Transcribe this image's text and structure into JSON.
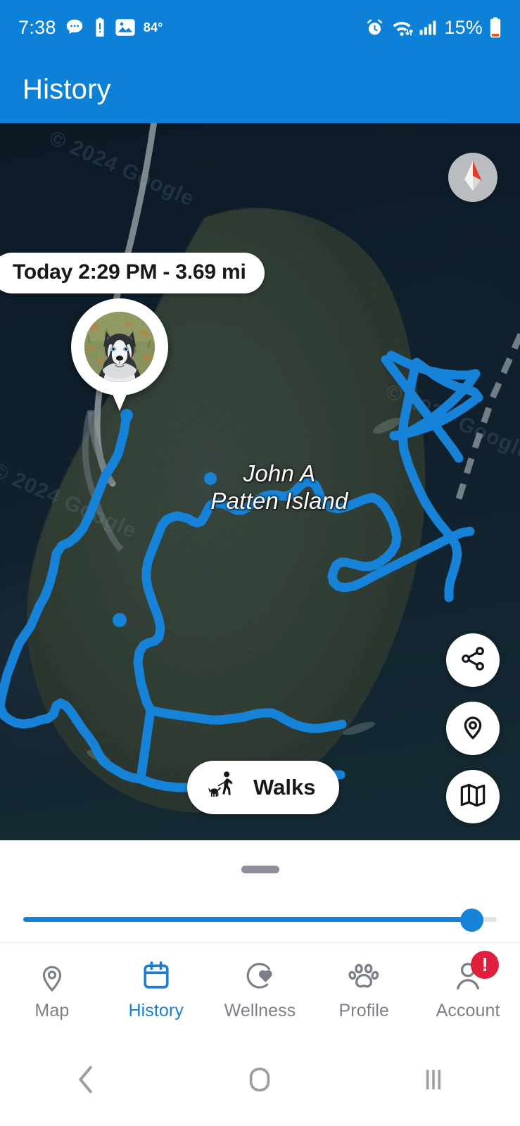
{
  "status_bar": {
    "time": "7:38",
    "temperature": "84°",
    "battery_percent": "15%",
    "icons": [
      "message-icon",
      "battery-alert-icon",
      "photo-icon",
      "alarm-icon",
      "wifi-icon",
      "cellular-signal-icon",
      "battery-icon"
    ]
  },
  "app_bar": {
    "title": "History"
  },
  "map": {
    "place_label_line1": "John A",
    "place_label_line2": "Patten Island",
    "watermark": "© 2024 Google",
    "compass_name": "compass-control",
    "info_pill": "Today 2:29 PM - 3.69 mi",
    "marker_name": "dog-photo-marker",
    "track_color": "#1683d8",
    "activity_chip": {
      "label": "Walks",
      "icon": "person-walking-dog-icon"
    },
    "fabs": [
      {
        "name": "share-fab",
        "icon": "share-icon"
      },
      {
        "name": "locate-fab",
        "icon": "location-pin-icon"
      },
      {
        "name": "map-layers-fab",
        "icon": "map-icon"
      }
    ]
  },
  "sheet": {
    "grabber_name": "sheet-drag-handle",
    "slider": {
      "name": "timeline-slider",
      "value_percent": 94.7,
      "fill_color": "#1683d8",
      "track_color": "#dfe1e6"
    }
  },
  "bottom_nav": {
    "active_color": "#1a7fd4",
    "inactive_color": "#7b7f88",
    "items": [
      {
        "label": "Map",
        "icon": "location-pin-icon",
        "active": false,
        "badge": ""
      },
      {
        "label": "History",
        "icon": "calendar-icon",
        "active": true,
        "badge": ""
      },
      {
        "label": "Wellness",
        "icon": "heart-activity-icon",
        "active": false,
        "badge": ""
      },
      {
        "label": "Profile",
        "icon": "paw-icon",
        "active": false,
        "badge": ""
      },
      {
        "label": "Account",
        "icon": "person-icon",
        "active": false,
        "badge": "!"
      }
    ]
  },
  "android_nav": {
    "back": "back-icon",
    "home": "home-icon",
    "recents": "recents-icon"
  }
}
